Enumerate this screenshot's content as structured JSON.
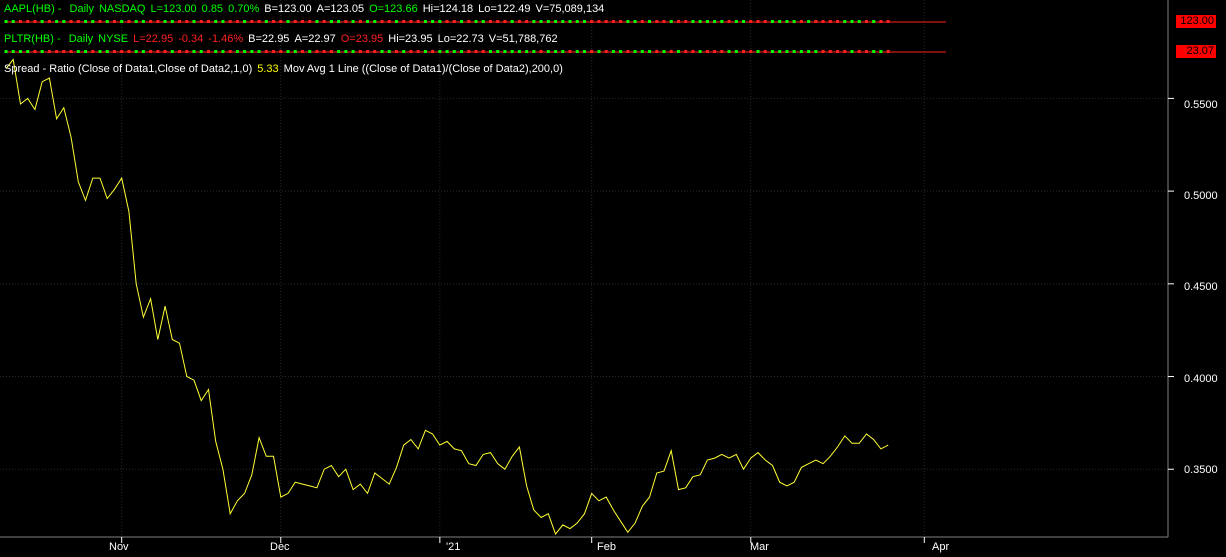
{
  "data1": {
    "symbol": "AAPL(HB)",
    "interval": "Daily",
    "exchange": "NASDAQ",
    "last": "L=123.00",
    "change": "0.85",
    "pct": "0.70%",
    "bid": "B=123.00",
    "ask": "A=123.05",
    "open": "O=123.66",
    "hi": "Hi=124.18",
    "lo": "Lo=122.49",
    "vol": "V=75,089,134",
    "price_box": "123.00"
  },
  "data2": {
    "symbol": "PLTR(HB)",
    "interval": "Daily",
    "exchange": "NYSE",
    "last": "L=22.95",
    "change": "-0.34",
    "pct": "-1.46%",
    "bid": "B=22.95",
    "ask": "A=22.97",
    "open": "O=23.95",
    "hi": "Hi=23.95",
    "lo": "Lo=22.73",
    "vol": "V=51,788,762",
    "price_box": "23.07"
  },
  "indicator": {
    "label": "Spread - Ratio (Close of Data1,Close of Data2,1,0)",
    "value": "5.33",
    "ma_label": "Mov Avg 1 Line ((Close of Data1)/(Close of Data2),200,0)"
  },
  "colors": {
    "ratio_line": "#ffff33",
    "up": "#00ff00",
    "down": "#ff2020",
    "grid": "#2a2a2a",
    "price_box": "#ff0000"
  },
  "chart_data": {
    "type": "line",
    "x_labels": [
      "Nov",
      "Dec",
      "'21",
      "Feb",
      "Mar",
      "Apr"
    ],
    "y_ticks": [
      "0.5500",
      "0.5000",
      "0.4500",
      "0.4000",
      "0.3500"
    ],
    "ylim": [
      0.314,
      0.5664
    ],
    "x_range": [
      0,
      130
    ],
    "x_label_positions": [
      16,
      38,
      60,
      81,
      103,
      127
    ],
    "series": [
      {
        "values": [
          0.566,
          0.571,
          0.547,
          0.55,
          0.544,
          0.559,
          0.561,
          0.539,
          0.545,
          0.529,
          0.505,
          0.495,
          0.507,
          0.507,
          0.496,
          0.501,
          0.507,
          0.489,
          0.45,
          0.432,
          0.442,
          0.42,
          0.438,
          0.42,
          0.418,
          0.4,
          0.398,
          0.387,
          0.393,
          0.365,
          0.35,
          0.326,
          0.333,
          0.337,
          0.347,
          0.367,
          0.357,
          0.357,
          0.335,
          0.337,
          0.343,
          0.342,
          0.341,
          0.34,
          0.35,
          0.352,
          0.346,
          0.35,
          0.339,
          0.342,
          0.337,
          0.348,
          0.345,
          0.342,
          0.351,
          0.363,
          0.366,
          0.361,
          0.371,
          0.369,
          0.363,
          0.365,
          0.361,
          0.36,
          0.353,
          0.352,
          0.358,
          0.359,
          0.353,
          0.35,
          0.357,
          0.362,
          0.341,
          0.328,
          0.324,
          0.326,
          0.315,
          0.32,
          0.318,
          0.321,
          0.326,
          0.337,
          0.333,
          0.335,
          0.328,
          0.322,
          0.316,
          0.321,
          0.33,
          0.335,
          0.348,
          0.349,
          0.36,
          0.339,
          0.34,
          0.346,
          0.347,
          0.355,
          0.356,
          0.358,
          0.356,
          0.358,
          0.35,
          0.356,
          0.359,
          0.355,
          0.352,
          0.343,
          0.341,
          0.343,
          0.351,
          0.353,
          0.355,
          0.353,
          0.357,
          0.362,
          0.368,
          0.364,
          0.364,
          0.369,
          0.366,
          0.361,
          0.363
        ]
      }
    ]
  }
}
